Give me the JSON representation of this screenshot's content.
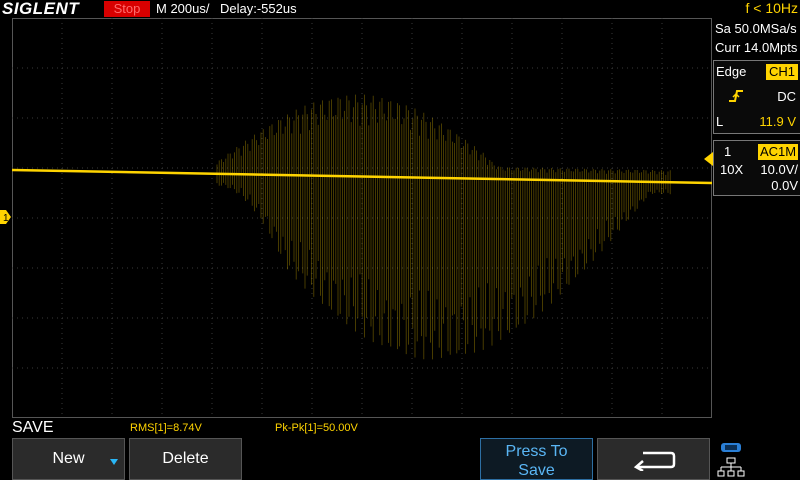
{
  "header": {
    "brand": "SIGLENT",
    "run_state": "Stop",
    "timebase": "M 200us/",
    "delay": "Delay:-552us",
    "trigger_freq": "f < 10Hz"
  },
  "acquisition": {
    "sample_rate": "Sa 50.0MSa/s",
    "memory_depth": "Curr 14.0Mpts"
  },
  "trigger": {
    "type": "Edge",
    "source": "CH1",
    "coupling": "DC",
    "level_label": "L",
    "level": "11.9 V"
  },
  "channel1": {
    "number": "1",
    "coupling": "AC1M",
    "probe": "10X",
    "scale": "10.0V/",
    "offset": "0.0V"
  },
  "measurements": {
    "rms": "RMS[1]=8.74V",
    "pkpk": "Pk-Pk[1]=50.00V"
  },
  "menu": {
    "title": "SAVE",
    "new_label": "New",
    "delete_label": "Delete",
    "press_to_save_line1": "Press To",
    "press_to_save_line2": "Save"
  },
  "colors": {
    "channel1": "#ffd400",
    "trigger_marker": "#29b6f6",
    "stop_bg": "#d80000"
  },
  "icons": {
    "back": "return-arrow-icon",
    "network": "network-icon"
  }
}
